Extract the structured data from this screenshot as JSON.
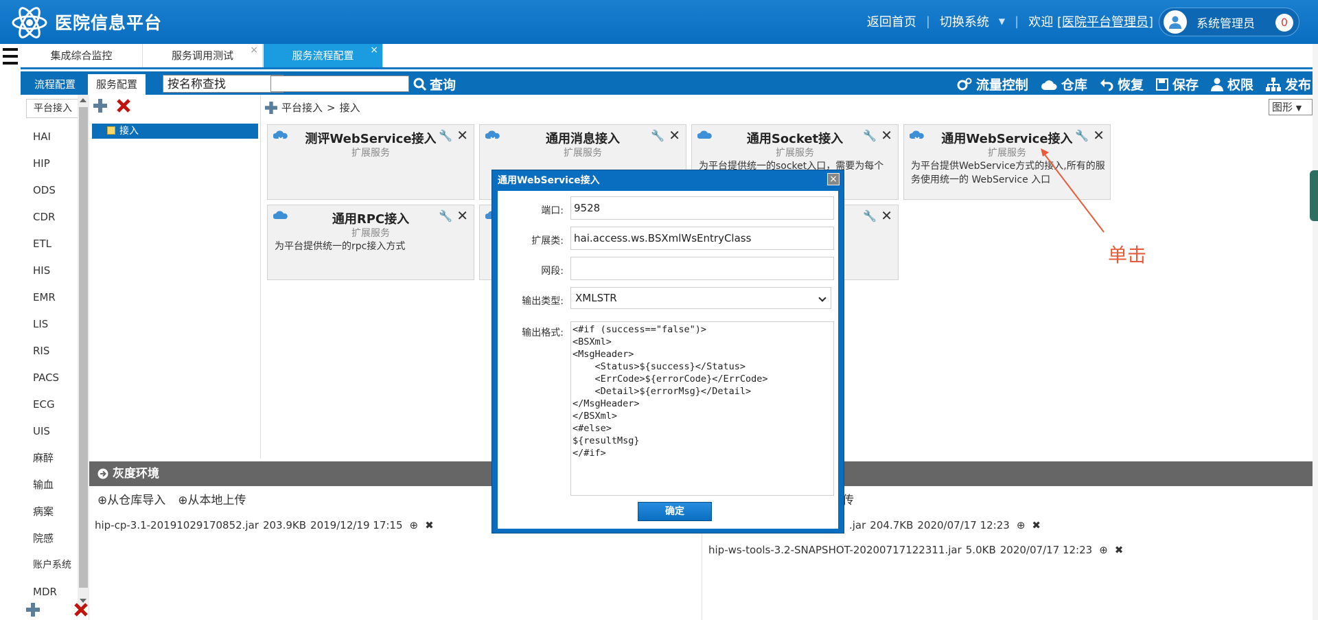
{
  "header": {
    "title": "医院信息平台",
    "home_link": "返回首页",
    "switch_system": "切换系统",
    "welcome_prefix": "欢迎 [",
    "welcome_user": "医院平台管理员",
    "welcome_suffix": "]",
    "user_name": "系统管理员",
    "notification_count": "0"
  },
  "tabs": [
    {
      "label": "集成综合监控"
    },
    {
      "label": "服务调用测试"
    },
    {
      "label": "服务流程配置"
    }
  ],
  "toolbar": {
    "subtab1": "流程配置",
    "subtab2": "服务配置",
    "search_mode": "按名称查找",
    "search_label": "查询",
    "actions": [
      "流量控制",
      "仓库",
      "恢复",
      "保存",
      "权限",
      "发布"
    ]
  },
  "sidebar": {
    "head": "平台接入",
    "items": [
      "HAI",
      "HIP",
      "ODS",
      "CDR",
      "ETL",
      "HIS",
      "EMR",
      "LIS",
      "RIS",
      "PACS",
      "ECG",
      "UIS",
      "麻醉",
      "输血",
      "病案",
      "院感",
      "账户系统",
      "MDR"
    ]
  },
  "tree": {
    "node": "接入"
  },
  "breadcrumb": {
    "root": "平台接入",
    "sep": ">",
    "current": "接入"
  },
  "view_select": "图形",
  "cards": [
    {
      "title": "测评WebService接入",
      "sub": "扩展服务",
      "desc": ""
    },
    {
      "title": "通用消息接入",
      "sub": "扩展服务",
      "desc": ""
    },
    {
      "title": "通用Socket接入",
      "sub": "扩展服务",
      "desc": "为平台提供统一的socket入口，需要为每个"
    },
    {
      "title": "通用WebService接入",
      "sub": "扩展服务",
      "desc": "为平台提供WebService方式的接入,所有的服务使用统一的 WebService 入口"
    },
    {
      "title": "通用RPC接入",
      "sub": "扩展服务",
      "desc": "为平台提供统一的rpc接入方式"
    }
  ],
  "annotation": "单击",
  "bottom": {
    "gray_title": "灰度环境",
    "import_repo": "从仓库导入",
    "upload_local": "从本地上传",
    "upload_right_fragment": "上传",
    "files_left": [
      {
        "name": "hip-cp-3.1-20191029170852.jar",
        "size": "203.9KB",
        "date": "2019/12/19 17:15"
      }
    ],
    "files_right": [
      {
        "name": ".jar",
        "size": "204.7KB",
        "date": "2020/07/17 12:23"
      },
      {
        "name": "hip-ws-tools-3.2-SNAPSHOT-20200717122311.jar",
        "size": "5.0KB",
        "date": "2020/07/17 12:23"
      }
    ]
  },
  "dialog": {
    "title": "通用WebService接入",
    "port_label": "端口:",
    "port_value": "9528",
    "class_label": "扩展类:",
    "class_value": "hai.access.ws.BSXmlWsEntryClass",
    "segment_label": "网段:",
    "segment_value": "",
    "output_type_label": "输出类型:",
    "output_type_value": "XMLSTR",
    "output_format_label": "输出格式:",
    "output_format_value": "<#if (success==\"false\")>\n<BSXml>\n<MsgHeader>\n    <Status>${success}</Status>\n    <ErrCode>${errorCode}</ErrCode>\n    <Detail>${errorMsg}</Detail>\n</MsgHeader>\n</BSXml>\n<#else>\n${resultMsg}\n</#if>",
    "ok_label": "确定"
  }
}
